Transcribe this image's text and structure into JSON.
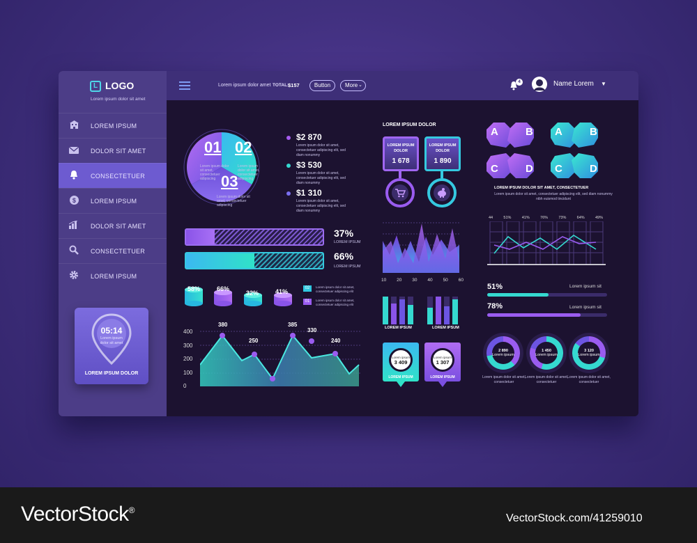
{
  "sidebar": {
    "logo_letter": "L",
    "logo": "LOGO",
    "tagline": "Lorem ipsum dolor sit amet",
    "items": [
      {
        "label": "LOREM IPSUM",
        "icon": "building-icon"
      },
      {
        "label": "DOLOR SIT AMET",
        "icon": "mail-icon"
      },
      {
        "label": "CONSECTETUER",
        "icon": "bell-icon",
        "active": true
      },
      {
        "label": "LOREM IPSUM",
        "icon": "dollar-icon"
      },
      {
        "label": "DOLOR SIT AMET",
        "icon": "bar-chart-icon"
      },
      {
        "label": "CONSECTETUER",
        "icon": "search-icon"
      },
      {
        "label": "LOREM IPSUM",
        "icon": "gear-icon"
      }
    ],
    "widget": {
      "time": "05:14",
      "sub": "Lorem ipsum dolor sit amet",
      "label": "LOREM IPSUM DOLOR"
    }
  },
  "topbar": {
    "text": "Lorem ipsum dolor amet",
    "total_label": "TOTAL:",
    "total_value": "$157",
    "button": "Button",
    "more": "More",
    "notifications": "4",
    "user": "Name Lorem"
  },
  "pie": {
    "segments": [
      "01",
      "02",
      "03"
    ],
    "caption": "Lorem ipsum dolor sit amet, consectetuer adipiscing",
    "values": [
      {
        "value": "$2 870",
        "text": "Lorem ipsum dolor sit amet, consectetuer adipiscing elit, sed diam nonummy",
        "color": "#a65cf0"
      },
      {
        "value": "$3 530",
        "text": "Lorem ipsum dolor sit amet, consectetuer adipiscing elit, sed diam nonummy",
        "color": "#35d9d0"
      },
      {
        "value": "$1 310",
        "text": "Lorem ipsum dolor sit amet, consectetuer adipiscing elit, sed diam nonummy",
        "color": "#7a6ff0"
      }
    ]
  },
  "bars": [
    {
      "percent": "37%",
      "label": "LOREM IPSUM",
      "fill": 0.21
    },
    {
      "percent": "66%",
      "label": "LOREM IPSUM",
      "fill": 0.5
    }
  ],
  "cylinders": [
    "58%",
    "66%",
    "32%",
    "41%"
  ],
  "cyl_legend": [
    {
      "num": "02",
      "text": "Lorem ipsum dolor sit amet, consectetuer adipiscing elit"
    },
    {
      "num": "01",
      "text": "Lorem ipsum dolor sit amet, consectetuer adipiscing elit"
    }
  ],
  "area_chart": {
    "y_ticks": [
      "400",
      "300",
      "200",
      "100",
      "0"
    ],
    "labels": [
      "380",
      "250",
      "385",
      "330",
      "240"
    ]
  },
  "center": {
    "title": "LOREM IPSUM DOLOR",
    "cards": [
      {
        "title": "LOREM IPSUM DOLOR",
        "value": "1 678"
      },
      {
        "title": "LOREM IPSUM DOLOR",
        "value": "1 890"
      }
    ],
    "mountain_x": [
      "10",
      "20",
      "30",
      "40",
      "50",
      "60"
    ],
    "bar_labels": [
      "LOREM IPSUM",
      "LOREM IPSUM"
    ],
    "pins": [
      {
        "label": "Lorem ipsum",
        "value": "3 409",
        "caption": "LOREM IPSUM"
      },
      {
        "label": "Lorem ipsum",
        "value": "1 307",
        "caption": "LOREM IPSUM"
      }
    ]
  },
  "right": {
    "letters": [
      "A",
      "B",
      "C",
      "D"
    ],
    "abcd_title": "LOREM IPSUM DOLOR SIT AMET, CONSECTETUER",
    "abcd_text": "Lorem ipsum dolor sit amet, consectetuer adipiscing elit, sed diam nonummy nibh euismod tincidunt",
    "line_top": [
      "44",
      "51%",
      "41%",
      "76%",
      "73%",
      "64%",
      "49%"
    ],
    "progress": [
      {
        "percent": "51%",
        "label": "Lorem ipsum sit",
        "fill": 0.51
      },
      {
        "percent": "78%",
        "label": "Lorem ipsum sit",
        "fill": 0.78
      }
    ],
    "donuts": [
      {
        "value": "2 890",
        "label": "Lorem ipsum",
        "caption": "Lorem ipsum dolor sit amet, consectetuer"
      },
      {
        "value": "1 450",
        "label": "Lorem ipsum",
        "caption": "Lorem ipsum dolor sit amet, consectetuer"
      },
      {
        "value": "3 120",
        "label": "Lorem ipsum",
        "caption": "Lorem ipsum dolor sit amet, consectetuer"
      }
    ]
  },
  "footer": {
    "brand": "VectorStock",
    "reg": "®",
    "url": "VectorStock.com/41259010"
  }
}
